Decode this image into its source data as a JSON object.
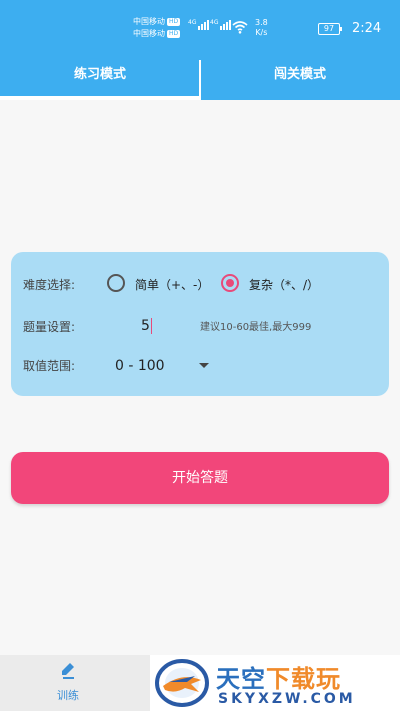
{
  "status_bar": {
    "carrier_1": "中国移动",
    "carrier_2": "中国移动",
    "hd_badge": "HD",
    "network_1": "4G",
    "network_2": "4G",
    "speed_value": "3.8",
    "speed_unit": "K/s",
    "battery": "97",
    "time": "2:24"
  },
  "tabs": [
    {
      "label": "练习模式",
      "active": true
    },
    {
      "label": "闯关模式",
      "active": false
    }
  ],
  "settings": {
    "difficulty_label": "难度选择:",
    "option_simple": "简单（+、-）",
    "option_complex": "复杂（*、/）",
    "selected_option": "complex",
    "count_label": "题量设置:",
    "count_value": "5",
    "count_hint": "建议10-60最佳,最大999",
    "range_label": "取值范围:",
    "range_value": "0 - 100"
  },
  "start_button": {
    "label": "开始答题"
  },
  "bottom_nav": {
    "items": [
      {
        "label": "训练",
        "icon": "pencil-icon"
      }
    ]
  },
  "watermark": {
    "title_part1": "天空",
    "title_part2": "下载玩",
    "url": "SKYXZW.COM"
  },
  "colors": {
    "primary": "#3daef0",
    "card_bg": "#aadcf5",
    "accent": "#f2467a"
  }
}
